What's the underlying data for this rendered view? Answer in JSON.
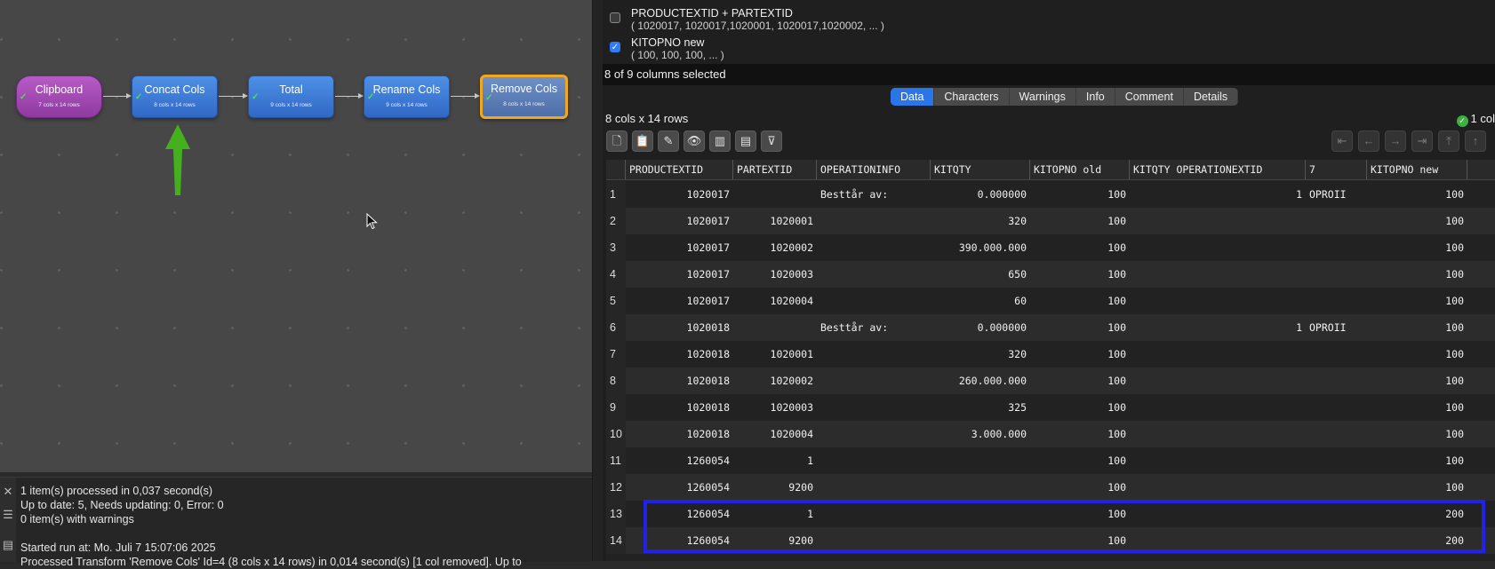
{
  "workflow": {
    "nodes": [
      {
        "title": "Clipboard",
        "sub": "7 cols x 14 rows"
      },
      {
        "title": "Concat Cols",
        "sub": "8 cols x 14 rows"
      },
      {
        "title": "Total",
        "sub": "9 cols x 14 rows"
      },
      {
        "title": "Rename Cols",
        "sub": "9 cols x 14 rows"
      },
      {
        "title": "Remove Cols",
        "sub": "8 cols x 14 rows"
      }
    ],
    "arrow_color": "#44b01e",
    "selected_border": "#f0a81e"
  },
  "log": {
    "lines": [
      "1 item(s) processed in 0,037 second(s)",
      "Up to date: 5, Needs updating: 0, Error: 0",
      "0 item(s) with warnings",
      "",
      "Started run at: Mo. Juli 7 15:07:06 2025",
      "  Processed Transform 'Remove Cols' Id=4 (8 cols x 14 rows) in 0,014 second(s) [1 col removed]. Up to"
    ]
  },
  "columns_panel": {
    "options": [
      {
        "name": "PRODUCTEXTID + PARTEXTID",
        "example": "( 1020017, 1020017,1020001, 1020017,1020002, ... )",
        "checked": false
      },
      {
        "name": "KITOPNO new",
        "example": "( 100, 100, 100, ... )",
        "checked": true
      }
    ],
    "selected_text": "8 of 9 columns selected"
  },
  "tabs": [
    "Data",
    "Characters",
    "Warnings",
    "Info",
    "Comment",
    "Details"
  ],
  "active_tab": "Data",
  "table_info": "8 cols x 14 rows",
  "status_right": "1 col",
  "toolbar": {
    "left": [
      "new-file-icon",
      "paste-icon",
      "edit-icon",
      "eye-icon",
      "columns-icon",
      "rows-icon",
      "filter-icon"
    ],
    "right": [
      "first-icon",
      "prev-icon",
      "next-icon",
      "last-icon",
      "top-icon",
      "up-icon"
    ]
  },
  "table": {
    "headers": [
      "PRODUCTEXTID",
      "PARTEXTID",
      "OPERATIONINFO",
      "KITQTY",
      "KITOPNO old",
      "KITQTY OPERATIONEXTID",
      "7",
      "KITOPNO new"
    ],
    "rows": [
      [
        "1",
        "1020017",
        "",
        "Besttår av:",
        "0.000000",
        "100",
        "1",
        "OPROII",
        "100"
      ],
      [
        "2",
        "1020017",
        "1020001",
        "",
        "320",
        "100",
        "",
        "",
        "100"
      ],
      [
        "3",
        "1020017",
        "1020002",
        "",
        "390.000.000",
        "100",
        "",
        "",
        "100"
      ],
      [
        "4",
        "1020017",
        "1020003",
        "",
        "650",
        "100",
        "",
        "",
        "100"
      ],
      [
        "5",
        "1020017",
        "1020004",
        "",
        "60",
        "100",
        "",
        "",
        "100"
      ],
      [
        "6",
        "1020018",
        "",
        "Besttår av:",
        "0.000000",
        "100",
        "1",
        "OPROII",
        "100"
      ],
      [
        "7",
        "1020018",
        "1020001",
        "",
        "320",
        "100",
        "",
        "",
        "100"
      ],
      [
        "8",
        "1020018",
        "1020002",
        "",
        "260.000.000",
        "100",
        "",
        "",
        "100"
      ],
      [
        "9",
        "1020018",
        "1020003",
        "",
        "325",
        "100",
        "",
        "",
        "100"
      ],
      [
        "10",
        "1020018",
        "1020004",
        "",
        "3.000.000",
        "100",
        "",
        "",
        "100"
      ],
      [
        "11",
        "1260054",
        "1",
        "",
        "",
        "100",
        "",
        "",
        "100"
      ],
      [
        "12",
        "1260054",
        "9200",
        "",
        "",
        "100",
        "",
        "",
        "100"
      ],
      [
        "13",
        "1260054",
        "1",
        "",
        "",
        "100",
        "",
        "",
        "200"
      ],
      [
        "14",
        "1260054",
        "9200",
        "",
        "",
        "100",
        "",
        "",
        "200"
      ]
    ],
    "highlight_color": "#2222e6"
  }
}
